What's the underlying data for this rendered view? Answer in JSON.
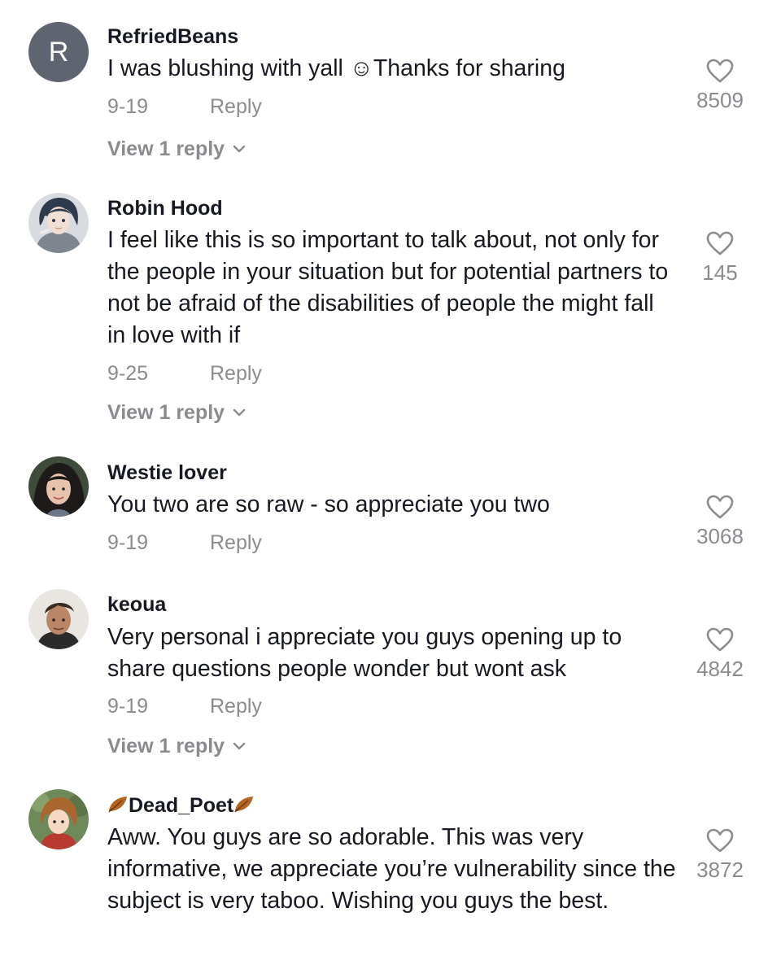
{
  "comments": [
    {
      "avatar_letter": "R",
      "username": "RefriedBeans",
      "text": "I was blushing with yall ☺︎Thanks for sharing",
      "date": "9-19",
      "reply_label": "Reply",
      "likes": "8509",
      "view_replies": "View 1 reply"
    },
    {
      "username": "Robin Hood",
      "text": "I feel like this is so important to talk about, not only for the people in your situation but for potential partners to not be afraid of the disabilities of people the might fall in love with if",
      "date": "9-25",
      "reply_label": "Reply",
      "likes": "145",
      "view_replies": "View 1 reply"
    },
    {
      "username": "Westie lover",
      "text": "You two are so raw - so appreciate you two",
      "date": "9-19",
      "reply_label": "Reply",
      "likes": "3068"
    },
    {
      "username": "keoua",
      "text": "Very personal i appreciate you guys opening up to share questions people wonder but wont ask",
      "date": "9-19",
      "reply_label": "Reply",
      "likes": "4842",
      "view_replies": "View 1 reply"
    },
    {
      "username": "Dead_Poet",
      "username_decoration_icon": "autumn-leaf-icon",
      "text": "Aww. You guys are so adorable. This was very informative, we appreciate you’re vulnerability since the subject is very taboo. Wishing you guys the best.",
      "likes": "3872"
    }
  ],
  "colors": {
    "text_primary": "#161823",
    "text_secondary": "#8a8b91",
    "avatar_default_bg": "#5e6570",
    "leaf": "#b5651d"
  }
}
